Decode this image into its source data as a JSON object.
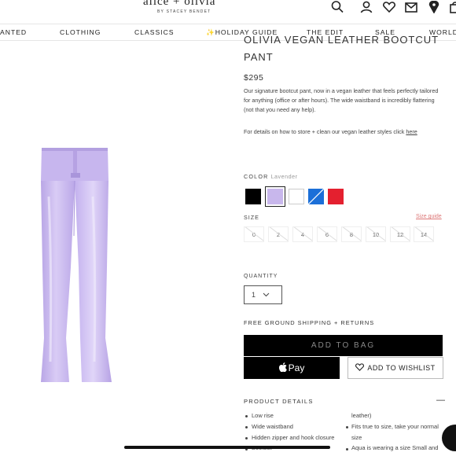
{
  "brand": {
    "logo_text": "alice + olivia",
    "logo_sub": "BY STACEY BENDET"
  },
  "header_icons": [
    "search-icon",
    "user-icon",
    "heart-icon",
    "mail-icon",
    "location-icon",
    "bag-icon"
  ],
  "nav": {
    "items": [
      "ANTED",
      "CLOTHING",
      "CLASSICS",
      "✨HOLIDAY GUIDE",
      "THE EDIT",
      "SALE",
      "WORLD"
    ]
  },
  "product": {
    "title_line1": "OLIVIA VEGAN LEATHER BOOTCUT",
    "title_line2": "PANT",
    "price": "$295",
    "description": "Our signature bootcut pant, now in a vegan leather that feels perfectly tailored for anything (office or after hours). The wide waistband is incredibly flattering (not that you need any help).",
    "care_text": "For details on how to store + clean our vegan leather styles click",
    "care_link": "here"
  },
  "color": {
    "label": "COLOR",
    "value": "Lavender",
    "swatches": [
      {
        "name": "black",
        "hex": "#000000"
      },
      {
        "name": "lavender",
        "hex": "#c8b7ec",
        "selected": true
      },
      {
        "name": "white",
        "hex": "#ffffff"
      },
      {
        "name": "blue",
        "hex": "#1b6fd8"
      },
      {
        "name": "red",
        "hex": "#e4202f"
      }
    ]
  },
  "size": {
    "label": "SIZE",
    "guide_label": "Size guide",
    "options": [
      "0",
      "2",
      "4",
      "6",
      "8",
      "10",
      "12",
      "14"
    ]
  },
  "quantity": {
    "label": "QUANTITY",
    "value": "1"
  },
  "shipping_text": "FREE GROUND SHIPPING + RETURNS",
  "buttons": {
    "add_to_bag": "ADD TO BAG",
    "apple_pay": "Pay",
    "wishlist": "ADD TO WISHLIST"
  },
  "details": {
    "header": "PRODUCT DETAILS",
    "toggle": "—",
    "left_bullets": [
      "Low rise",
      "Wide waistband",
      "Hidden zipper and hook closure",
      "Bootcut"
    ],
    "right_lines": [
      "leather)",
      "Fits true to size, take your normal",
      "size",
      "Aqua is wearing a size Small and"
    ]
  },
  "colors": {
    "accent": "#000000",
    "lavender": "#c8b7ec",
    "size_guide": "#d77777"
  }
}
